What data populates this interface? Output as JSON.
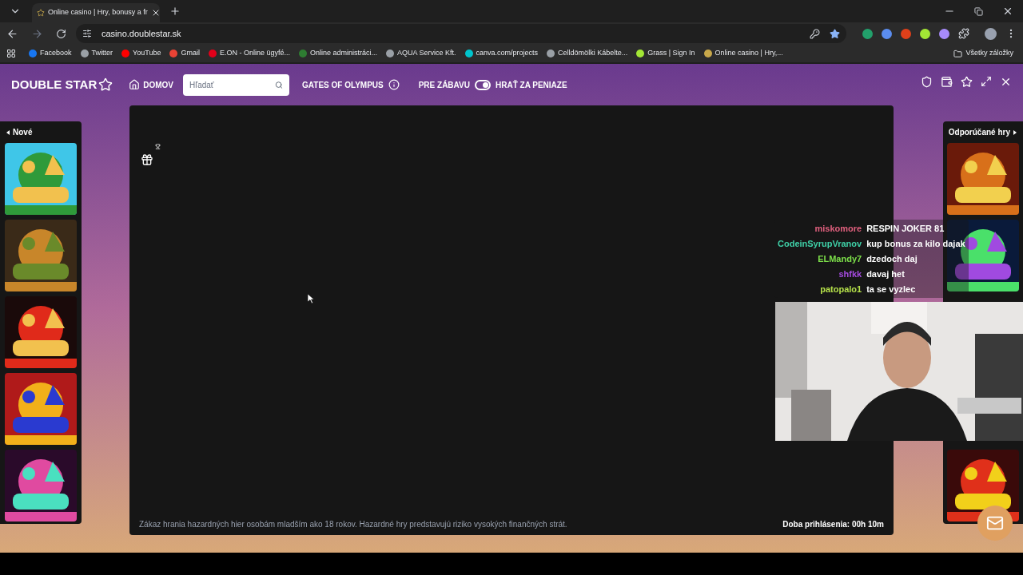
{
  "browser": {
    "tab_title": "Online casino | Hry, bonusy a fr",
    "url": "casino.doublestar.sk",
    "bookmarks": [
      {
        "label": "Facebook"
      },
      {
        "label": "Twitter"
      },
      {
        "label": "YouTube"
      },
      {
        "label": "Gmail"
      },
      {
        "label": "E.ON - Online ügyfé..."
      },
      {
        "label": "Online administráci..."
      },
      {
        "label": "AQUA Service Kft."
      },
      {
        "label": "canva.com/projects"
      },
      {
        "label": "Celldömölki Kábelte..."
      },
      {
        "label": "Grass | Sign In"
      },
      {
        "label": "Online casino | Hry,..."
      }
    ],
    "all_bookmarks": "Všetky záložky"
  },
  "site": {
    "logo": "DOUBLE STAR",
    "home": "DOMOV",
    "search": {
      "placeholder": "Hľadať"
    },
    "game_title": "GATES OF OLYMPUS",
    "mode_left": "PRE ZÁBAVU",
    "mode_right": "HRAŤ ZA PENIAZE",
    "real_money": {
      "on": true
    }
  },
  "left_panel": {
    "title": "Nové"
  },
  "right_panel": {
    "title": "Odporúčané hry"
  },
  "chat": [
    {
      "user": "miskomore",
      "message": "RESPIN JOKER 81",
      "color": "#e0607e"
    },
    {
      "user": "CodeinSyrupVranov",
      "message": "kup bonus za kilo dajak",
      "color": "#3fd1a8"
    },
    {
      "user": "ELMandy7",
      "message": "dzedoch daj",
      "color": "#7de04a"
    },
    {
      "user": "shfkk",
      "message": "davaj het",
      "color": "#a54be0"
    },
    {
      "user": "patopalo1",
      "message": "ta se vyzlec",
      "color": "#b5e04a"
    }
  ],
  "game": {
    "disclaimer": "Zákaz hrania hazardných hier osobám mladším ako 18 rokov. Hazardné hry predstavujú riziko vysokých finančných strát.",
    "session": "Doba prihlásenia: 00h 10m"
  }
}
